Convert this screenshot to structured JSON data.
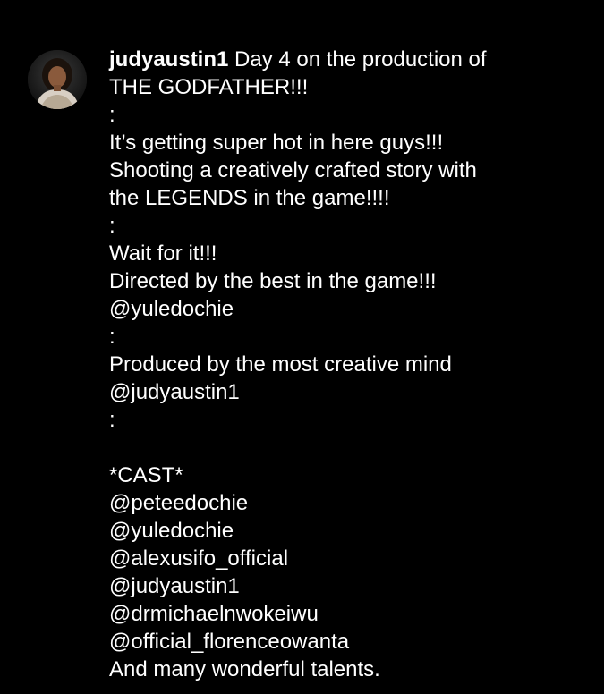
{
  "post": {
    "username": "judyaustin1",
    "first_line_text": " Day 4 on the production of",
    "lines": [
      "THE GODFATHER!!!",
      ":",
      "It’s getting super hot in here guys!!!",
      "Shooting a creatively crafted story with",
      "the LEGENDS in the game!!!!",
      ":",
      "Wait for it!!!",
      "Directed by the best in the game!!!",
      "@yuledochie",
      ":",
      "Produced by the most creative mind",
      "@judyaustin1",
      ":",
      "",
      "*CAST*",
      "@peteedochie",
      "@yuledochie",
      "@alexusifo_official",
      "@judyaustin1",
      "@drmichaelnwokeiwu",
      "@official_florenceowanta",
      "And many wonderful talents."
    ]
  },
  "colors": {
    "background": "#000000",
    "text": "#ffffff"
  },
  "avatar": {
    "icon": "profile-photo-avatar"
  }
}
